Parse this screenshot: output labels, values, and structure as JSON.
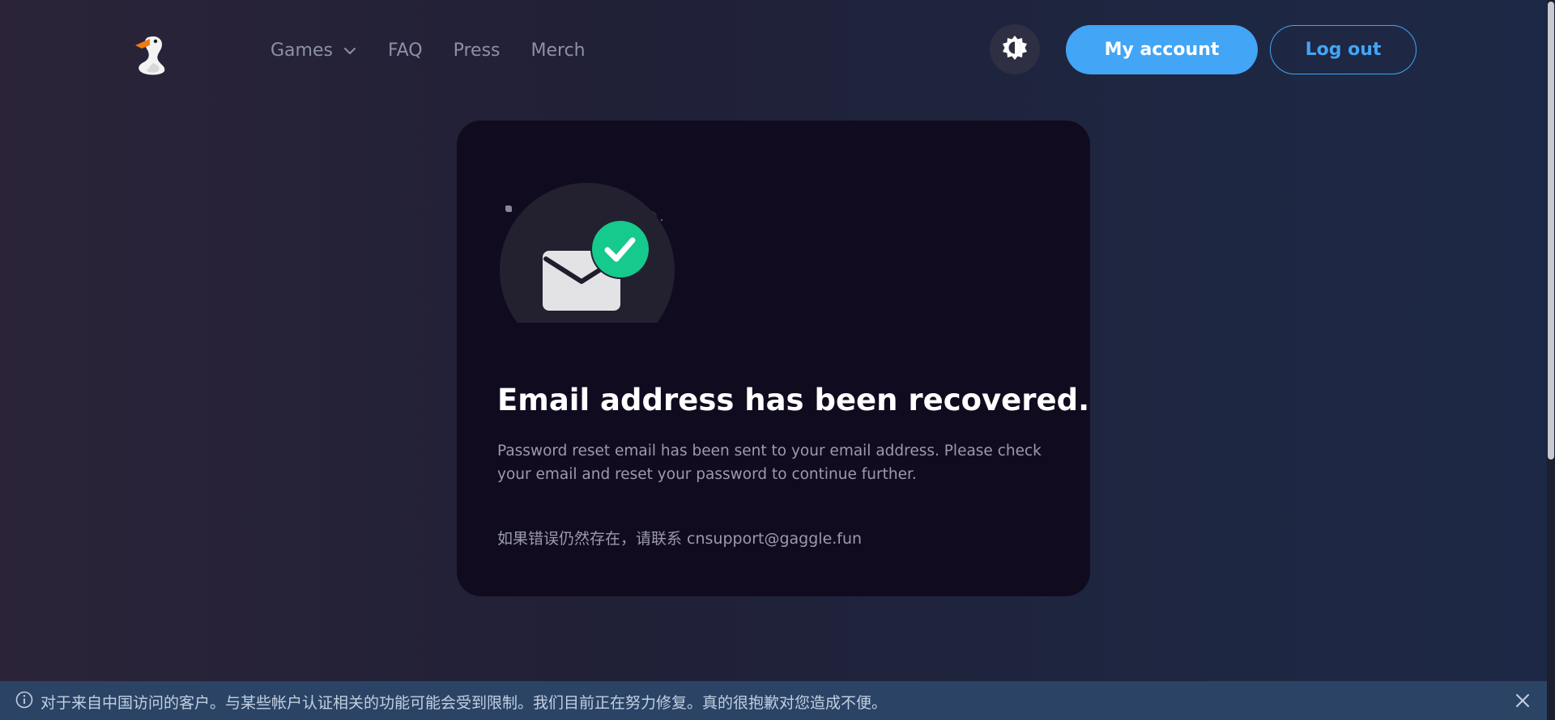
{
  "header": {
    "nav": [
      {
        "label": "Games",
        "has_dropdown": true
      },
      {
        "label": "FAQ"
      },
      {
        "label": "Press"
      },
      {
        "label": "Merch"
      }
    ],
    "theme_toggle_icon": "contrast-icon",
    "my_account_label": "My account",
    "logout_label": "Log out"
  },
  "card": {
    "title": "Email address has been recovered.",
    "description": "Password reset email has been sent to your email address. Please check your email and reset your password to continue further.",
    "support": "如果错误仍然存在，请联系 cnsupport@gaggle.fun"
  },
  "notice": {
    "text": "对于来自中国访问的客户。与某些帐户认证相关的功能可能会受到限制。我们目前正在努力修复。真的很抱歉对您造成不便。"
  },
  "colors": {
    "accent": "#42a5f5",
    "success": "#16c98d",
    "card_bg": "#100b1f",
    "notice_bg": "#2b4466"
  }
}
